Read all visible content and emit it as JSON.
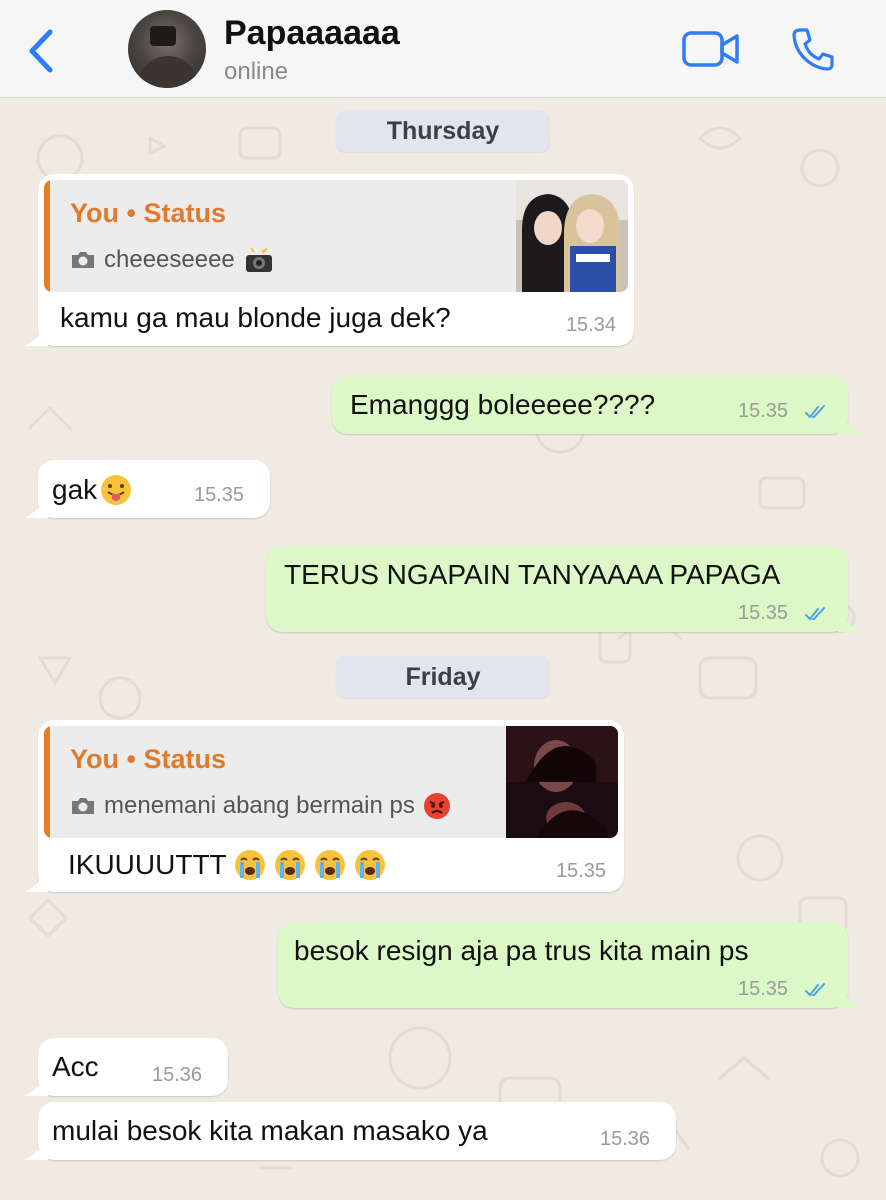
{
  "header": {
    "contact_name": "Papaaaaaa",
    "contact_status": "online",
    "accent_color": "#2f7cf6"
  },
  "days": {
    "first": "Thursday",
    "second": "Friday"
  },
  "messages": [
    {
      "direction": "incoming",
      "quote": {
        "title": "You • Status",
        "caption": "cheeeseeee",
        "caption_emoji": "camera-with-flash"
      },
      "text": "kamu ga mau blonde juga dek?",
      "time": "15.34"
    },
    {
      "direction": "outgoing",
      "text": "Emanggg boleeeee????",
      "time": "15.35",
      "read": true
    },
    {
      "direction": "incoming",
      "text": "gak",
      "text_emoji": "tongue-out-face",
      "time": "15.35"
    },
    {
      "direction": "outgoing",
      "text": "TERUS NGAPAIN TANYAAAA PAPAGA",
      "time": "15.35",
      "read": true
    },
    {
      "direction": "incoming",
      "quote": {
        "title": "You • Status",
        "caption": "menemani abang bermain ps",
        "caption_emoji": "angry-face"
      },
      "text": "IKUUUUTTT",
      "text_emoji": "loudly-crying-face x4",
      "time": "15.35"
    },
    {
      "direction": "outgoing",
      "text": "besok resign aja pa trus kita main ps",
      "time": "15.35",
      "read": true
    },
    {
      "direction": "incoming",
      "text": "Acc",
      "time": "15.36"
    },
    {
      "direction": "incoming",
      "text": "mulai besok kita makan masako ya",
      "time": "15.36"
    }
  ],
  "colors": {
    "incoming_bubble": "#ffffff",
    "outgoing_bubble": "#dcf8c6",
    "quote_accent": "#e67e22",
    "read_ticks": "#4fa3e0",
    "wallpaper": "#efeae2"
  }
}
